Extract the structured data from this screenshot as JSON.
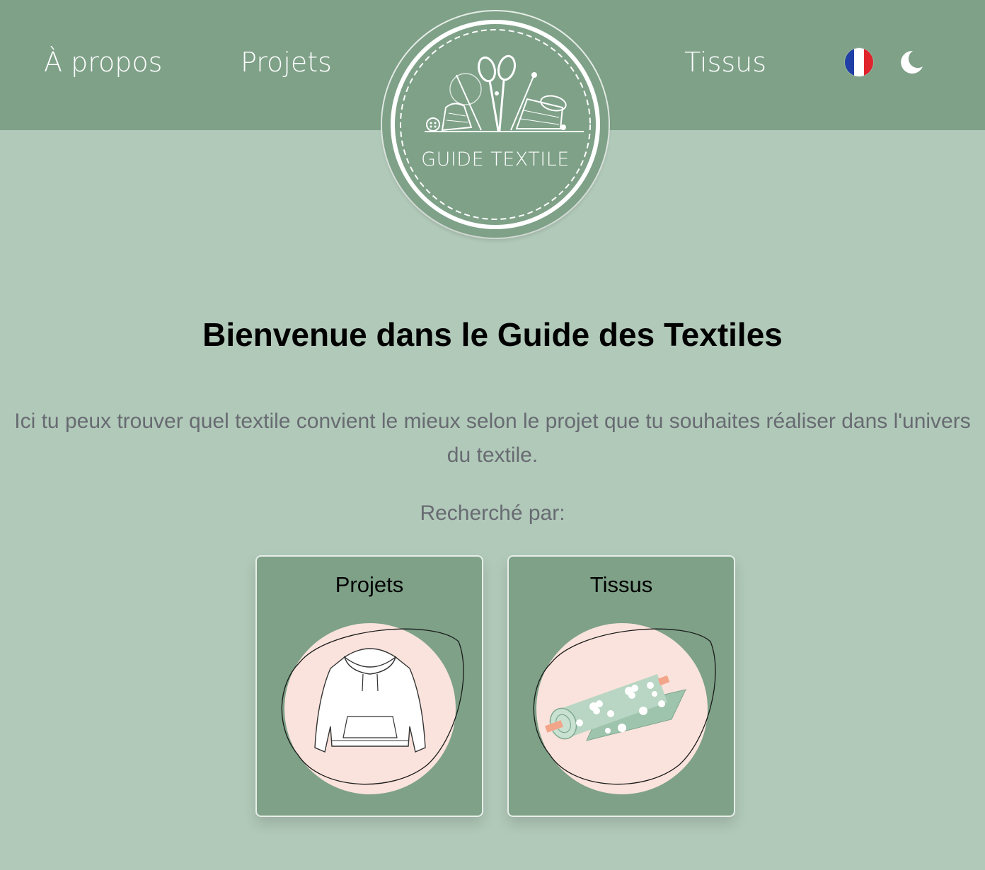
{
  "nav": {
    "about": "À propos",
    "projects": "Projets",
    "fabrics": "Tissus",
    "language_icon": "french-flag-icon",
    "theme_icon": "moon-icon"
  },
  "logo": {
    "text": "GUIDE TEXTILE"
  },
  "main": {
    "title": "Bienvenue dans le Guide des Textiles",
    "intro": "Ici tu peux trouver quel textile convient le mieux selon le projet que tu souhaites réaliser dans l'univers du textile.",
    "search_label": "Recherché par:"
  },
  "cards": [
    {
      "title": "Projets",
      "icon": "hoodie-icon"
    },
    {
      "title": "Tissus",
      "icon": "fabric-roll-icon"
    }
  ],
  "colors": {
    "primary": "#7ea188",
    "background": "#b1c9b9",
    "card_circle": "#fae3dc",
    "text_muted": "#686b72"
  }
}
